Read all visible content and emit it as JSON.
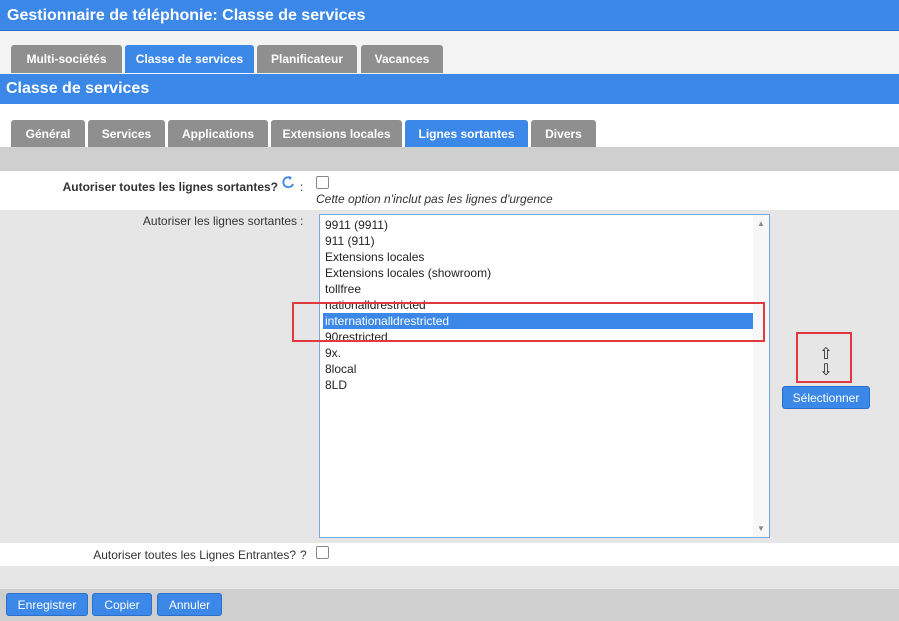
{
  "app": {
    "title": "Gestionnaire de téléphonie:  Classe de services"
  },
  "top_tabs": [
    {
      "label": "Multi-sociétés",
      "active": false
    },
    {
      "label": "Classe de services",
      "active": true
    },
    {
      "label": "Planificateur",
      "active": false
    },
    {
      "label": "Vacances",
      "active": false
    }
  ],
  "section": {
    "title": "Classe de services"
  },
  "sub_tabs": [
    {
      "label": "Général",
      "active": false
    },
    {
      "label": "Services",
      "active": false
    },
    {
      "label": "Applications",
      "active": false
    },
    {
      "label": "Extensions locales",
      "active": false
    },
    {
      "label": "Lignes sortantes",
      "active": true
    },
    {
      "label": "Divers",
      "active": false
    }
  ],
  "form": {
    "allow_all_outgoing": {
      "label": "Autoriser toutes les lignes sortantes?",
      "separator": ":",
      "checked": false,
      "note": "Cette option n'inclut pas les lignes d'urgence",
      "icon": "refresh-icon"
    },
    "allow_outgoing_list": {
      "label": "Autoriser les lignes sortantes",
      "separator": ":",
      "options": [
        "9911 (9911)",
        "911 (911)",
        "Extensions locales",
        "Extensions locales (showroom)",
        "tollfree",
        "nationalldrestricted",
        "internationalldrestricted",
        "90restricted",
        "9x.",
        "8local",
        "8LD"
      ],
      "selected": "internationalldrestricted",
      "reorder_icons": [
        "arrow-up-icon",
        "arrow-down-icon"
      ],
      "select_button": "Sélectionner"
    },
    "allow_all_incoming": {
      "label": "Autoriser toutes les Lignes Entrantes?",
      "checked": false
    }
  },
  "footer": {
    "save": "Enregistrer",
    "copy": "Copier",
    "cancel": "Annuler"
  },
  "colors": {
    "accent": "#3b88e8",
    "tab_inactive": "#8f8f8f",
    "highlight": "#e0393e"
  }
}
